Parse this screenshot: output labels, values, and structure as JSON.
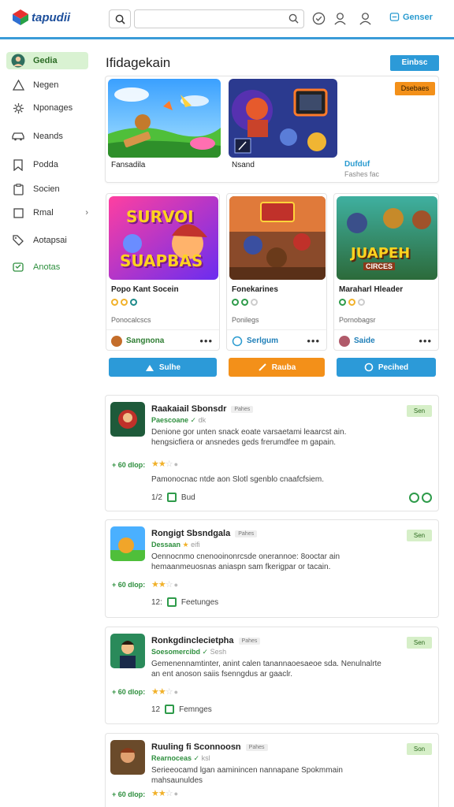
{
  "header": {
    "brand": "tapudii",
    "search_placeholder": "",
    "cta_label": "Genser"
  },
  "sidebar": {
    "items": [
      {
        "label": "Gedia",
        "icon": "avatar-icon",
        "active": true
      },
      {
        "label": "Negen",
        "icon": "triangle-icon"
      },
      {
        "label": "Nponages",
        "icon": "gear-icon"
      },
      {
        "label": "Neands",
        "icon": "car-icon"
      },
      {
        "label": "Podda",
        "icon": "bookmark-icon"
      },
      {
        "label": "Socien",
        "icon": "clipboard-icon"
      },
      {
        "label": "Rmal",
        "icon": "square-icon",
        "chevron": "›"
      },
      {
        "label": "Aotapsai",
        "icon": "tag-icon"
      },
      {
        "label": "Anotas",
        "icon": "gamepad-icon",
        "green": true
      }
    ]
  },
  "main": {
    "title": "Ifidagekain",
    "top_button": "Einbsc",
    "orange_button": "Dsebaes",
    "featured": [
      {
        "caption": "Fansadila",
        "sub": ""
      },
      {
        "caption": "Nsand",
        "sub": ""
      },
      {
        "caption": "Dufduf",
        "sub": "Fashes fac",
        "blue": true
      }
    ],
    "cards": [
      {
        "art_line1": "SURVOI",
        "art_line2": "SUAPBAS",
        "title": "Popo Kant Socein",
        "sub": "Ponocalcscs",
        "author": "Sangnona",
        "button": "Sulhe",
        "color": "#2c9ad8"
      },
      {
        "title": "Fonekarines",
        "sub": "Ponilegs",
        "author": "Serlgum",
        "button": "Rauba",
        "color": "#f39019"
      },
      {
        "art_line1": "JUAPEH",
        "art_line2": "CIRCES",
        "title": "Maraharl Hleader",
        "sub": "Pornobagsr",
        "author": "Saide",
        "button": "Pecihed",
        "color": "#2c9ad8"
      }
    ],
    "list": [
      {
        "title": "Raakaiail Sbonsdr",
        "tag": "Pahes",
        "publisher": "Paescoane",
        "publisher_extra": "dk",
        "desc": "Denione gor unten snack eoate varsaetami leaarcst ain. hengsicfiera or ansnedes geds frerumdfee m gapain.",
        "price": "+ 60 dlop:",
        "extra": "Pamonocnac ntde aon Slotl sgenblo cnaafcfsiem.",
        "meta_num": "1/2",
        "meta_label": "Bud",
        "button": "Sen"
      },
      {
        "title": "Rongigt Sbsndgala",
        "tag": "Pahes",
        "publisher": "Dessaan",
        "publisher_extra": "eifi",
        "desc": "Oennocnmo cnenooinonrcsde onerannoe: 8ooctar ain hemaanmeuosnas aniaspn sam fkerigpar or tacain.",
        "price": "+ 60 dlop:",
        "meta_num": "12:",
        "meta_label": "Feetunges",
        "button": "Sen"
      },
      {
        "title": "Ronkgdinclecietpha",
        "tag": "Pahes",
        "publisher": "Soesomercibd",
        "publisher_extra": "Sesh",
        "desc": "Gemenennamtinter, anint calen tanannaoesaeoe sda. Nenulnalrte an ent anoson saiis fsenngdus ar gaaclr.",
        "price": "+ 60 dlop:",
        "meta_num": "12",
        "meta_label": "Femnges",
        "button": "Sen"
      },
      {
        "title": "Ruuling fi Sconnoosn",
        "tag": "Pahes",
        "publisher": "Rearnoceas",
        "publisher_extra": "ksl",
        "desc": "Serieeocamd lgan aaminincen nannapane Spokmmain mahsaunuldes",
        "price": "+ 60 dlop:",
        "meta_num": "",
        "meta_label": "",
        "button": "Son"
      }
    ]
  },
  "colors": {
    "accent_blue": "#2c9ad8",
    "accent_orange": "#f39019",
    "accent_green": "#2e9b4a"
  }
}
